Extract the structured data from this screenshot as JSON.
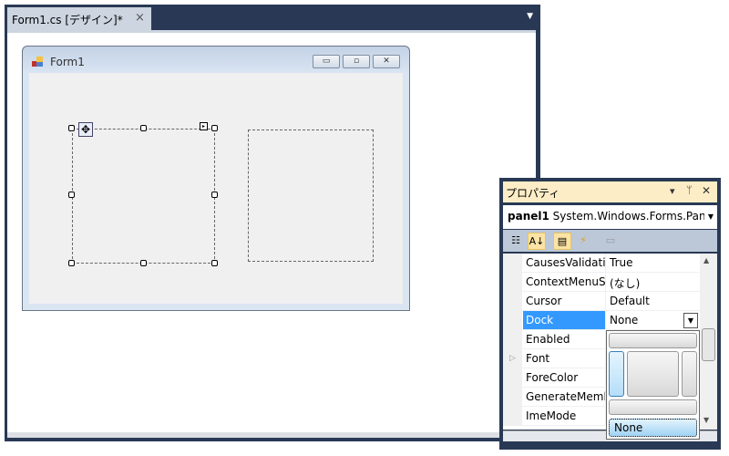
{
  "document_tab": {
    "label": "Form1.cs [デザイン]*",
    "close": "×",
    "menu": "▼"
  },
  "form": {
    "title": "Form1",
    "buttons": {
      "minimize": "▭",
      "maximize": "▫",
      "close": "✕"
    }
  },
  "properties": {
    "title": "プロパティ",
    "title_buttons": {
      "dropdown": "▾",
      "pin": "ᛘ",
      "close": "✕"
    },
    "object_name": "panel1",
    "object_type": "System.Windows.Forms.Panel",
    "rows": [
      {
        "name": "CausesValidation",
        "value": "True"
      },
      {
        "name": "ContextMenuStrip",
        "value": "(なし)"
      },
      {
        "name": "Cursor",
        "value": "Default"
      },
      {
        "name": "Dock",
        "value": "None",
        "selected": true
      },
      {
        "name": "Enabled",
        "value": ""
      },
      {
        "name": "Font",
        "value": "",
        "expandable": true
      },
      {
        "name": "ForeColor",
        "value": ""
      },
      {
        "name": "GenerateMember",
        "value": ""
      },
      {
        "name": "ImeMode",
        "value": ""
      }
    ],
    "dock_dropdown": {
      "none_label": "None"
    }
  },
  "colors": {
    "frame": "#293955",
    "selection": "#3399ff"
  }
}
